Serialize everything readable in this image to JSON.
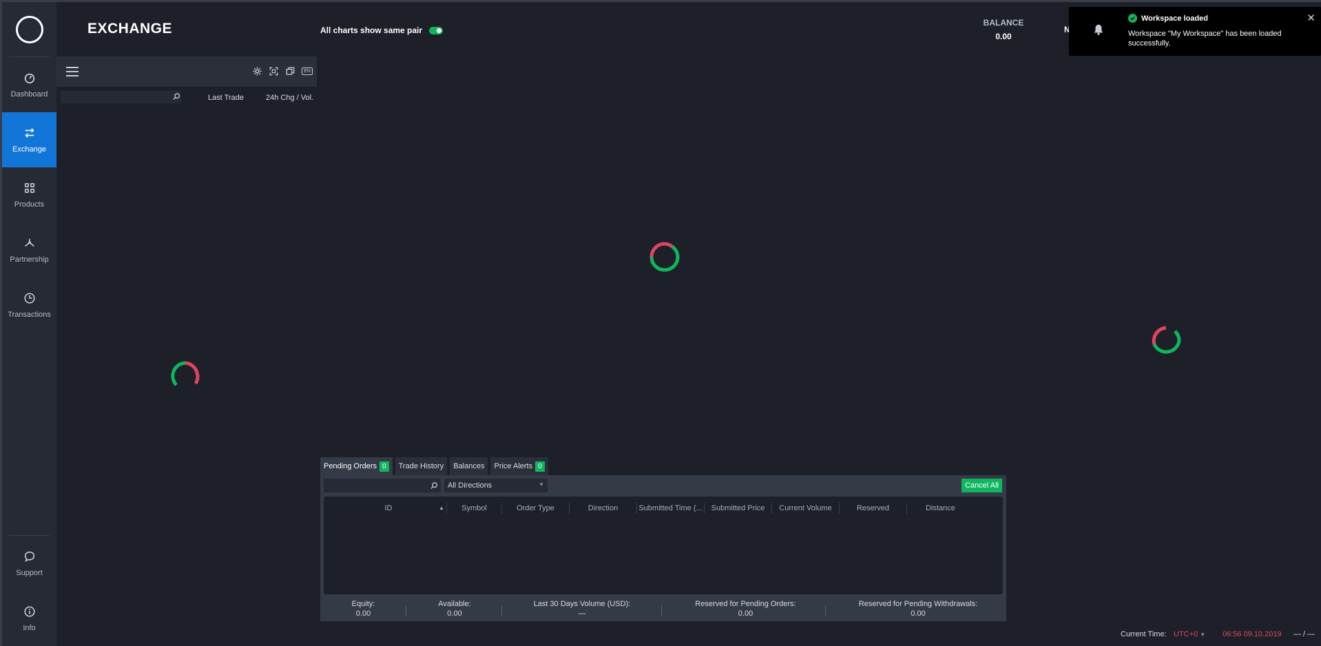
{
  "app": {
    "title": "EXCHANGE"
  },
  "sidebar": {
    "items": [
      {
        "label": "Dashboard",
        "icon": "dashboard-icon"
      },
      {
        "label": "Exchange",
        "icon": "exchange-icon"
      },
      {
        "label": "Products",
        "icon": "products-icon"
      },
      {
        "label": "Partnership",
        "icon": "partnership-icon"
      },
      {
        "label": "Transactions",
        "icon": "transactions-icon"
      }
    ],
    "bottom_items": [
      {
        "label": "Support",
        "icon": "support-icon"
      },
      {
        "label": "Info",
        "icon": "info-icon"
      }
    ]
  },
  "header": {
    "same_pair_label": "All charts show same pair",
    "same_pair_enabled": true,
    "balance_label": "BALANCE",
    "balance_value": "0.00",
    "truncated_label": "N"
  },
  "notification": {
    "title": "Workspace loaded",
    "message": "Workspace \"My Workspace\" has been loaded successfully."
  },
  "market": {
    "lang": "EN",
    "search_value": "",
    "columns": [
      "Last Trade",
      "24h Chg / Vol."
    ]
  },
  "orders": {
    "tabs": [
      {
        "label": "Pending Orders",
        "count": "0"
      },
      {
        "label": "Trade History",
        "count": null
      },
      {
        "label": "Balances",
        "count": null
      },
      {
        "label": "Price Alerts",
        "count": "0"
      }
    ],
    "direction_filter": "All Directions",
    "cancel_all_label": "Cancel All",
    "columns": [
      "ID",
      "Symbol",
      "Order Type",
      "Direction",
      "Submitted Time (...",
      "Submitted Price",
      "Current Volume",
      "Reserved",
      "Distance"
    ],
    "summary": [
      {
        "label": "Equity:",
        "value": "0.00"
      },
      {
        "label": "Available:",
        "value": "0.00"
      },
      {
        "label": "Last 30 Days Volume (USD):",
        "value": "—"
      },
      {
        "label": "Reserved for Pending Orders:",
        "value": "0.00"
      },
      {
        "label": "Reserved for Pending Withdrawals:",
        "value": "0.00"
      }
    ]
  },
  "footer": {
    "current_time_label": "Current Time:",
    "timezone": "UTC+0",
    "time_value": "06:56 09.10.2019",
    "extra": "— / —"
  },
  "colors": {
    "accent": "#1176d7",
    "green": "#10b65f",
    "red": "#e0445f"
  }
}
